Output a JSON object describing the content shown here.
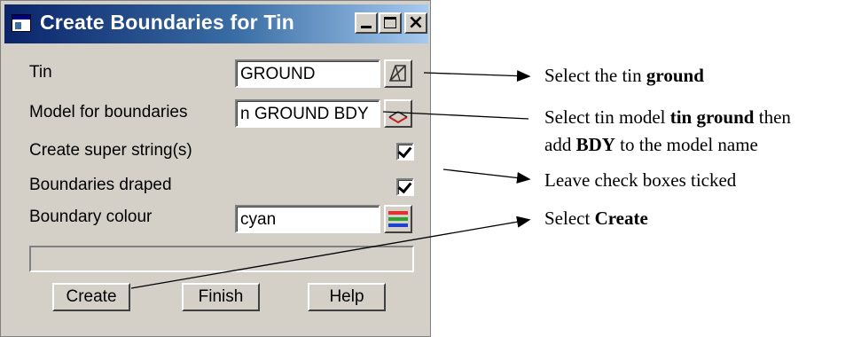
{
  "window": {
    "title": "Create Boundaries for Tin",
    "controls": [
      "minimize",
      "maximize",
      "close"
    ]
  },
  "fields": {
    "tin_label": "Tin",
    "tin_value": "GROUND",
    "model_label": "Model for boundaries",
    "model_value": "n GROUND BDY",
    "super_label": "Create super string(s)",
    "super_checked": true,
    "draped_label": "Boundaries draped",
    "draped_checked": true,
    "colour_label": "Boundary colour",
    "colour_value": "cyan"
  },
  "buttons": {
    "create": "Create",
    "finish": "Finish",
    "help": "Help"
  },
  "icons": {
    "tin_pick": "tin-select-icon",
    "model_pick": "model-select-icon",
    "colour_pick": "colour-select-icon"
  },
  "annotations": {
    "a1_text": "Select the tin ",
    "a1_bold": "ground",
    "a2_text": "Select tin model ",
    "a2_bold": "tin ground",
    "a2_suffix": " then",
    "a2_line2_text": "add ",
    "a2_line2_bold": "BDY",
    "a2_line2_suffix": " to the model name",
    "a3_text": "Leave check boxes ticked",
    "a4_text": "Select ",
    "a4_bold": "Create"
  },
  "colors": {
    "title_bar": "#0a246a",
    "dialog_bg": "#d4d0c8",
    "colour_swatch": [
      "#e03030",
      "#30a030",
      "#2040d0"
    ]
  }
}
